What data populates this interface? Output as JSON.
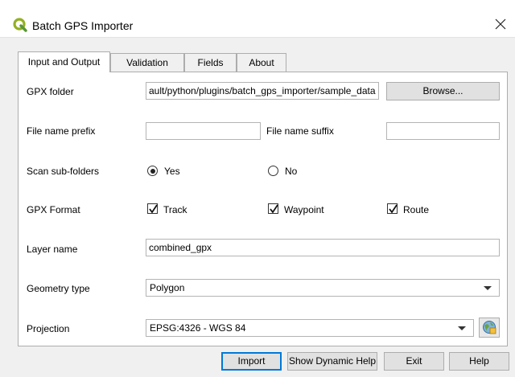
{
  "window": {
    "title": "Batch GPS Importer",
    "app_icon": "qgis-logo-icon",
    "close_icon": "close-icon"
  },
  "tabs": [
    {
      "label": "Input and Output",
      "active": true
    },
    {
      "label": "Validation",
      "active": false
    },
    {
      "label": "Fields",
      "active": false
    },
    {
      "label": "About",
      "active": false
    }
  ],
  "form": {
    "gpx_folder": {
      "label": "GPX folder",
      "value": "ault/python/plugins/batch_gps_importer/sample_data",
      "browse_label": "Browse..."
    },
    "file_name_prefix": {
      "label": "File name prefix",
      "value": ""
    },
    "file_name_suffix": {
      "label": "File name suffix",
      "value": ""
    },
    "scan_sub_folders": {
      "label": "Scan sub-folders",
      "options": [
        {
          "label": "Yes",
          "checked": true
        },
        {
          "label": "No",
          "checked": false
        }
      ]
    },
    "gpx_format": {
      "label": "GPX Format",
      "options": [
        {
          "label": "Track",
          "checked": true
        },
        {
          "label": "Waypoint",
          "checked": true
        },
        {
          "label": "Route",
          "checked": true
        }
      ]
    },
    "layer_name": {
      "label": "Layer name",
      "value": "combined_gpx"
    },
    "geometry_type": {
      "label": "Geometry type",
      "selected": "Polygon"
    },
    "projection": {
      "label": "Projection",
      "selected": "EPSG:4326 - WGS 84",
      "selector_icon": "crs-globe-icon"
    }
  },
  "footer": {
    "import_label": "Import",
    "dynamic_help_label": "Show Dynamic Help",
    "exit_label": "Exit",
    "help_label": "Help"
  },
  "colors": {
    "accent": "#0078d7",
    "qgis_green": "#93b023",
    "dialog_bg": "#f0f0f0"
  }
}
